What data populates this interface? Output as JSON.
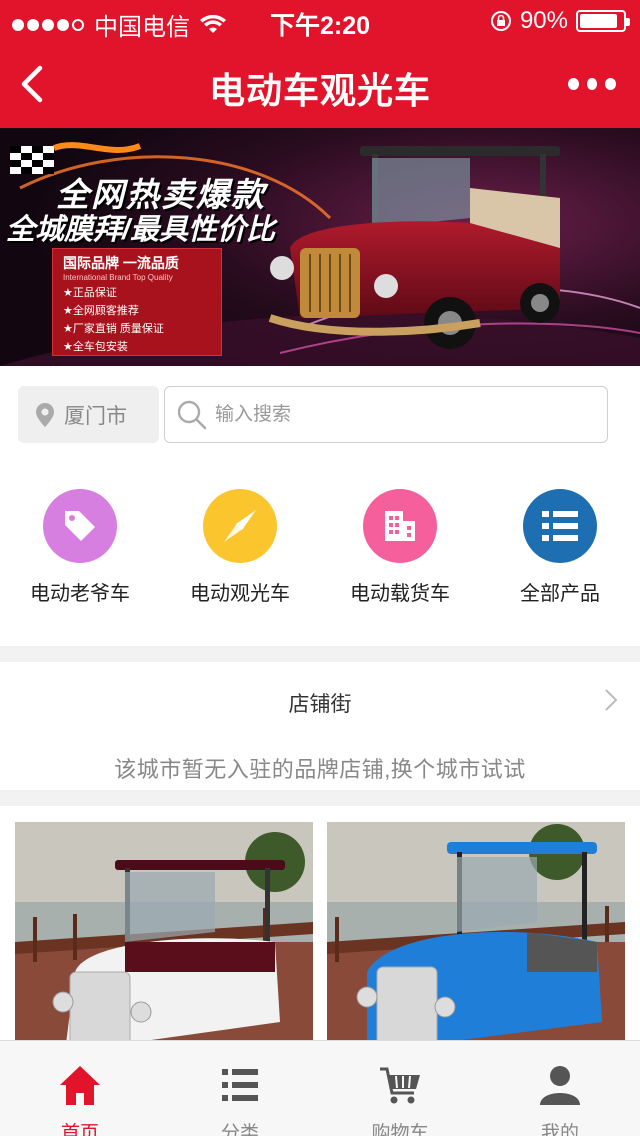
{
  "status_bar": {
    "carrier": "中国电信",
    "time": "下午2:20",
    "battery": "90%",
    "battery_level": 0.9
  },
  "nav": {
    "title": "电动车观光车"
  },
  "banner": {
    "headline": "全网热卖爆款",
    "subheadline": "全城膜拜/最具性价比",
    "box_title": "国际品牌 一流品质",
    "box_subtitle": "International Brand  Top Quality",
    "bullets": [
      "★正品保证",
      "★全网顾客推荐",
      "★厂家直销 质量保证",
      "★全车包安装"
    ]
  },
  "search": {
    "city": "厦门市",
    "placeholder": "输入搜索"
  },
  "categories": [
    {
      "label": "电动老爷车",
      "icon": "tag-icon",
      "color": "#d77fe0"
    },
    {
      "label": "电动观光车",
      "icon": "compass-icon",
      "color": "#fbc52d"
    },
    {
      "label": "电动载货车",
      "icon": "building-icon",
      "color": "#f55f9b"
    },
    {
      "label": "全部产品",
      "icon": "list-icon",
      "color": "#1d6fb1"
    }
  ],
  "shop_street": {
    "title": "店铺街",
    "empty_message": "该城市暂无入驻的品牌店铺,换个城市试试"
  },
  "products": [
    {
      "name": "white-maroon-classic-car",
      "body_color": "#f2f2f2",
      "roof_color": "#5a0d1a"
    },
    {
      "name": "blue-classic-car",
      "body_color": "#1f7fd8",
      "roof_color": "#1f7fd8"
    }
  ],
  "tabs": [
    {
      "label": "首页",
      "icon": "home-icon",
      "active": true
    },
    {
      "label": "分类",
      "icon": "list-icon",
      "active": false
    },
    {
      "label": "购物车",
      "icon": "cart-icon",
      "active": false
    },
    {
      "label": "我的",
      "icon": "user-icon",
      "active": false
    }
  ],
  "colors": {
    "brand": "#e2142b",
    "inactive": "#888888"
  }
}
